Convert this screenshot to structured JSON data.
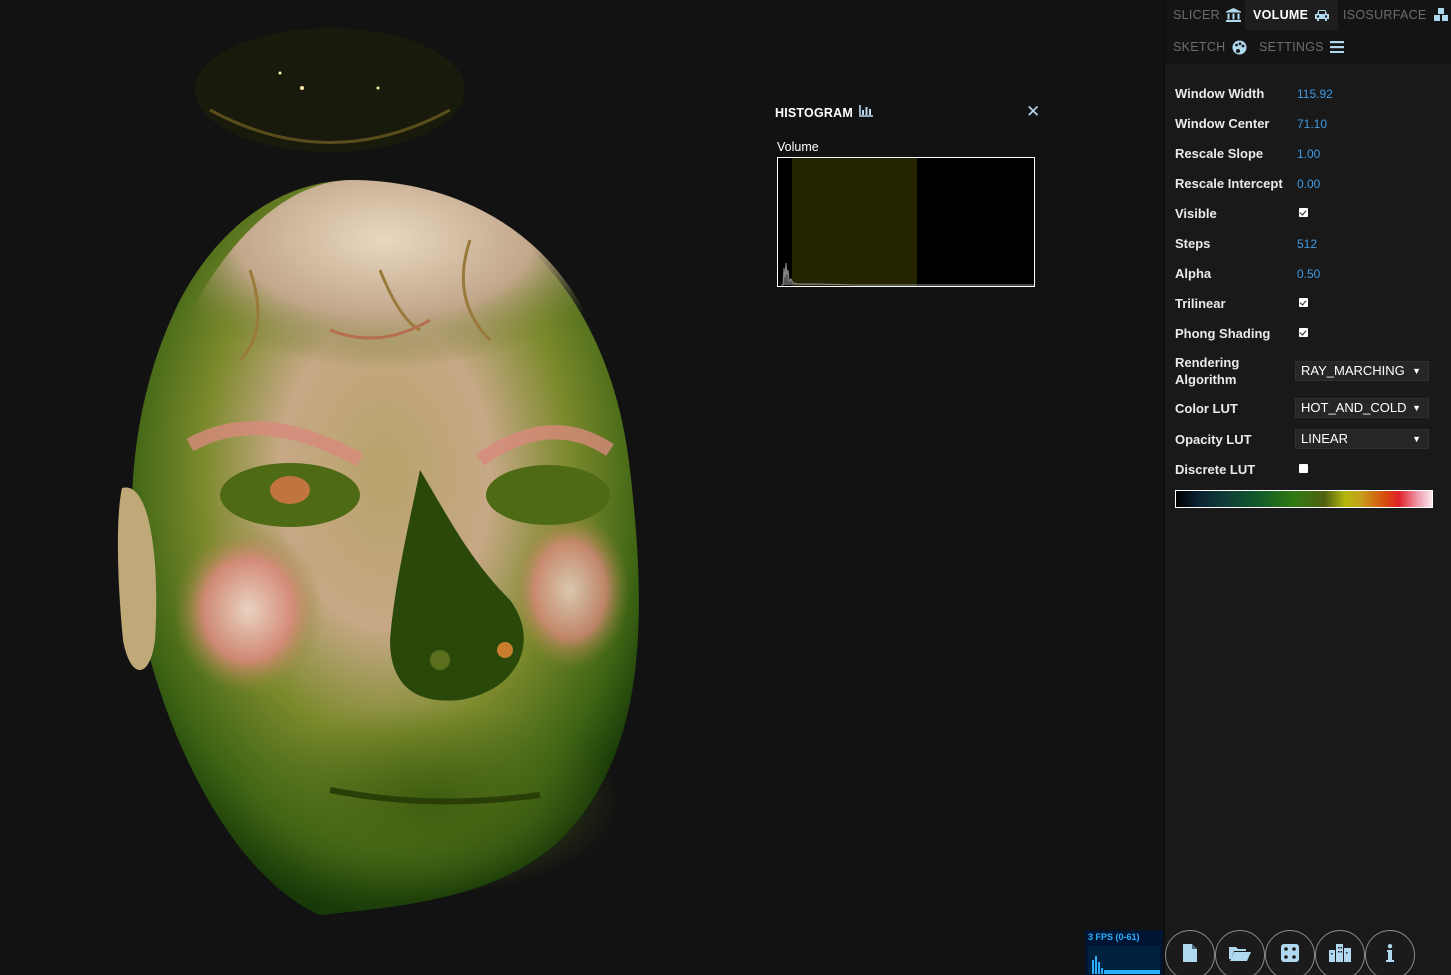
{
  "histogram": {
    "title": "HISTOGRAM",
    "close_glyph": "✕",
    "label": "Volume",
    "icon": "bar-chart-icon"
  },
  "tabs": [
    {
      "label": "SLICER",
      "icon": "institution-icon",
      "active": false
    },
    {
      "label": "VOLUME",
      "icon": "car-icon",
      "active": true
    },
    {
      "label": "ISOSURFACE",
      "icon": "cubes-icon",
      "active": false
    },
    {
      "label": "SKETCH",
      "icon": "palette-icon",
      "active": false
    },
    {
      "label": "SETTINGS",
      "icon": "menu-icon",
      "active": false
    }
  ],
  "properties": {
    "window_width": {
      "label": "Window Width",
      "value": "115.92"
    },
    "window_center": {
      "label": "Window Center",
      "value": "71.10"
    },
    "rescale_slope": {
      "label": "Rescale Slope",
      "value": "1.00"
    },
    "rescale_intercept": {
      "label": "Rescale Intercept",
      "value": "0.00"
    },
    "visible": {
      "label": "Visible",
      "checked": true
    },
    "steps": {
      "label": "Steps",
      "value": "512"
    },
    "alpha": {
      "label": "Alpha",
      "value": "0.50"
    },
    "trilinear": {
      "label": "Trilinear",
      "checked": true
    },
    "phong_shading": {
      "label": "Phong Shading",
      "checked": true
    },
    "rendering_algorithm": {
      "label_line1": "Rendering",
      "label_line2": "Algorithm",
      "value": "RAY_MARCHING"
    },
    "color_lut": {
      "label": "Color LUT",
      "value": "HOT_AND_COLD"
    },
    "opacity_lut": {
      "label": "Opacity LUT",
      "value": "LINEAR"
    },
    "discrete_lut": {
      "label": "Discrete LUT",
      "checked": false
    }
  },
  "dropdown_caret": "▼",
  "fps": {
    "text": "3 FPS (0-61)"
  },
  "bottom_buttons": [
    {
      "icon": "file-icon"
    },
    {
      "icon": "folder-open-icon"
    },
    {
      "icon": "dice-icon"
    },
    {
      "icon": "city-icon"
    },
    {
      "icon": "info-icon"
    }
  ],
  "colors": {
    "accent": "#3d9be6",
    "panel_bg": "#191919",
    "viewport_bg": "#121212",
    "histogram_selection": "#2a2a06"
  }
}
